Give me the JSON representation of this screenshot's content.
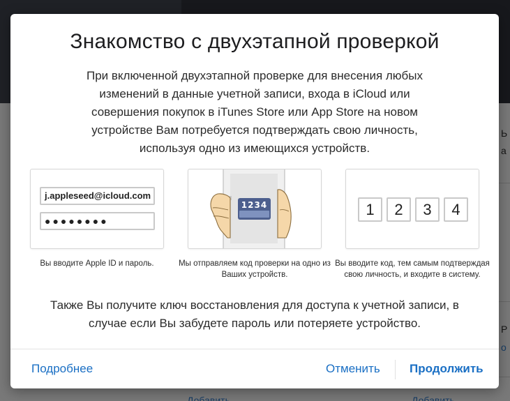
{
  "background": {
    "right_text_1": "Ь",
    "right_text_2": "а",
    "right_text_3": "Р",
    "right_link_1": "о",
    "bottom_link_1": "Добавить...",
    "bottom_link_2": "Добавить"
  },
  "modal": {
    "title": "Знакомство с двухэтапной проверкой",
    "intro": "При включенной двухэтапной проверке для внесения любых изменений в данные учетной записи, входа в iCloud или совершения покупок в iTunes Store или App Store на новом устройстве Вам потребуется подтверждать свою личность, используя одно из имеющихся устройств.",
    "steps": [
      {
        "apple_id": "j.appleseed@icloud.com",
        "password": "●●●●●●●●",
        "caption": "Вы вводите Apple ID и пароль."
      },
      {
        "code": "1234",
        "caption": "Мы отправляем код проверки на одно из Ваших устройств."
      },
      {
        "digits": [
          "1",
          "2",
          "3",
          "4"
        ],
        "caption": "Вы вводите код, тем самым подтверждая свою личность, и входите в систему."
      }
    ],
    "recovery_note": "Также Вы получите ключ восстановления для доступа к учетной записи, в случае если Вы забудете пароль или потеряете устройство.",
    "footer": {
      "more": "Подробнее",
      "cancel": "Отменить",
      "continue": "Продолжить"
    }
  },
  "colors": {
    "link": "#1a6fc4",
    "badge": "#4d5f8e"
  }
}
